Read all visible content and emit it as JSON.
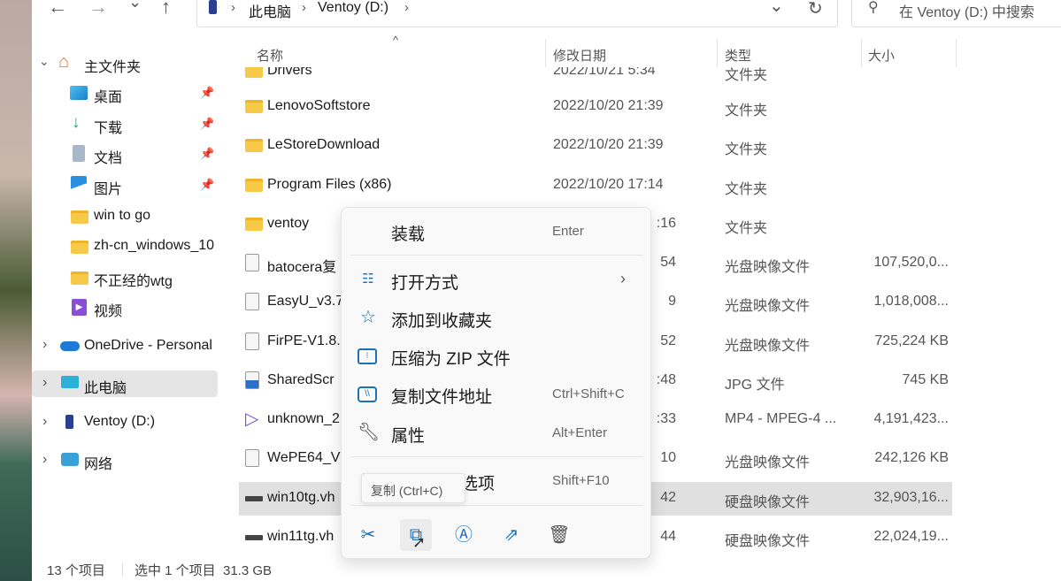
{
  "toolbar": {
    "back": "←",
    "forward": "→",
    "recent": "⌄",
    "up": "↑",
    "refresh": "↻",
    "dropdown": "⌄"
  },
  "breadcrumb": [
    "此电脑",
    "Ventoy (D:)"
  ],
  "search": {
    "placeholder": "在 Ventoy (D:) 中搜索"
  },
  "sidebar": {
    "items": [
      {
        "label": "主文件夹",
        "icon": "home-icon",
        "expand": "⌄"
      },
      {
        "label": "桌面",
        "icon": "desktop-icon",
        "pinned": true
      },
      {
        "label": "下载",
        "icon": "download-icon",
        "pinned": true
      },
      {
        "label": "文档",
        "icon": "documents-icon",
        "pinned": true
      },
      {
        "label": "图片",
        "icon": "pictures-icon",
        "pinned": true
      },
      {
        "label": "win to go",
        "icon": "folder-icon"
      },
      {
        "label": "zh-cn_windows_10",
        "icon": "folder-icon"
      },
      {
        "label": "不正经的wtg",
        "icon": "folder-icon"
      },
      {
        "label": "视频",
        "icon": "videos-icon"
      },
      {
        "label": "OneDrive - Personal",
        "icon": "onedrive-icon",
        "expand": "›"
      },
      {
        "label": "此电脑",
        "icon": "this-pc-icon",
        "expand": "›",
        "selected": true
      },
      {
        "label": "Ventoy (D:)",
        "icon": "drive-icon",
        "expand": "›"
      },
      {
        "label": "网络",
        "icon": "network-icon",
        "expand": "›"
      }
    ]
  },
  "columns": {
    "name": "名称",
    "date": "修改日期",
    "type": "类型",
    "size": "大小",
    "sort_icon": "^"
  },
  "files": [
    {
      "name": "Drivers",
      "date": "2022/10/21 5:34",
      "type": "文件夹",
      "size": "",
      "icon": "folder"
    },
    {
      "name": "LenovoSoftstore",
      "date": "2022/10/20 21:39",
      "type": "文件夹",
      "size": "",
      "icon": "folder"
    },
    {
      "name": "LeStoreDownload",
      "date": "2022/10/20 21:39",
      "type": "文件夹",
      "size": "",
      "icon": "folder"
    },
    {
      "name": "Program Files (x86)",
      "date": "2022/10/20 17:14",
      "type": "文件夹",
      "size": "",
      "icon": "folder"
    },
    {
      "name": "ventoy",
      "date": ":16",
      "type": "文件夹",
      "size": "",
      "icon": "folder"
    },
    {
      "name": "batocera复",
      "date": "54",
      "type": "光盘映像文件",
      "size": "107,520,0...",
      "icon": "disc"
    },
    {
      "name": "EasyU_v3.7",
      "date": "9",
      "type": "光盘映像文件",
      "size": "1,018,008...",
      "icon": "disc"
    },
    {
      "name": "FirPE-V1.8.",
      "date": "52",
      "type": "光盘映像文件",
      "size": "725,224 KB",
      "icon": "disc"
    },
    {
      "name": "SharedScr",
      "date": ":48",
      "type": "JPG 文件",
      "size": "745 KB",
      "icon": "image"
    },
    {
      "name": "unknown_2",
      "date": ":33",
      "type": "MP4 - MPEG-4 ...",
      "size": "4,191,423...",
      "icon": "video"
    },
    {
      "name": "WePE64_V",
      "date": "10",
      "type": "光盘映像文件",
      "size": "242,126 KB",
      "icon": "disc"
    },
    {
      "name": "win10tg.vh",
      "date": "42",
      "type": "硬盘映像文件",
      "size": "32,903,16...",
      "icon": "vhd",
      "selected": true
    },
    {
      "name": "win11tg.vh",
      "date": "44",
      "type": "硬盘映像文件",
      "size": "22,024,19...",
      "icon": "vhd"
    }
  ],
  "context_menu": {
    "items": [
      {
        "label": "装载",
        "shortcut": "Enter",
        "icon": ""
      },
      {
        "label": "打开方式",
        "shortcut": "",
        "icon": "open-with-icon",
        "submenu": "›"
      },
      {
        "label": "添加到收藏夹",
        "shortcut": "",
        "icon": "star-icon"
      },
      {
        "label": "压缩为 ZIP 文件",
        "shortcut": "",
        "icon": "zip-folder-icon"
      },
      {
        "label": "复制文件地址",
        "shortcut": "Ctrl+Shift+C",
        "icon": "copy-path-icon"
      },
      {
        "label": "属性",
        "shortcut": "Alt+Enter",
        "icon": "wrench-icon"
      },
      {
        "label": "选项",
        "shortcut": "Shift+F10",
        "icon": "more-options-icon"
      }
    ],
    "quick_actions": [
      "cut-icon",
      "copy-icon",
      "rename-icon",
      "share-icon",
      "delete-icon"
    ],
    "tooltip": "复制 (Ctrl+C)"
  },
  "status": {
    "count": "13 个项目",
    "selection": "选中 1 个项目  31.3 GB"
  },
  "colors": {
    "accent": "#1f6fb5",
    "folder": "#f7c948",
    "selection": "#e0e0e0"
  }
}
